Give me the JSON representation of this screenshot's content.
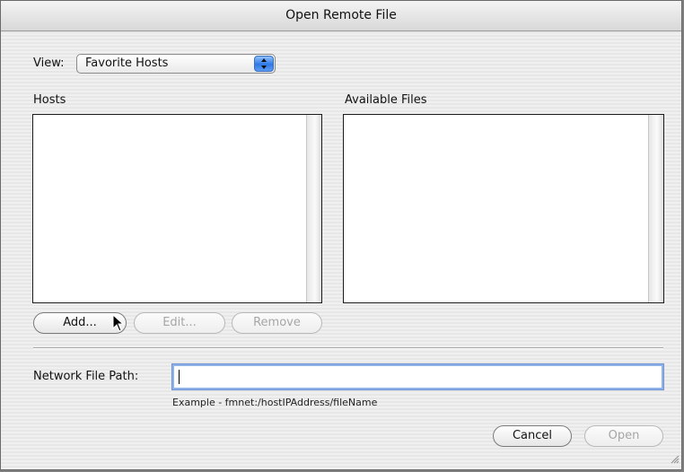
{
  "window": {
    "title": "Open Remote File"
  },
  "view": {
    "label": "View:",
    "selected": "Favorite Hosts"
  },
  "hosts": {
    "label": "Hosts",
    "items": [],
    "buttons": {
      "add": "Add...",
      "edit": "Edit...",
      "remove": "Remove"
    }
  },
  "files": {
    "label": "Available Files",
    "items": []
  },
  "network": {
    "label": "Network File Path:",
    "value": "",
    "example": "Example - fmnet:/hostIPAddress/fileName"
  },
  "footer": {
    "cancel": "Cancel",
    "open": "Open"
  }
}
